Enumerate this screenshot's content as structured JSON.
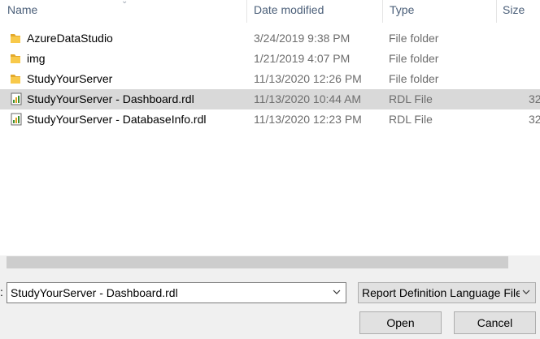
{
  "header": {
    "name": "Name",
    "date_modified": "Date modified",
    "type": "Type",
    "size": "Size"
  },
  "rows": [
    {
      "name": "AzureDataStudio",
      "date": "3/24/2019 9:38 PM",
      "type": "File folder",
      "size": "",
      "icon": "folder-icon",
      "selected": false
    },
    {
      "name": "img",
      "date": "1/21/2019 4:07 PM",
      "type": "File folder",
      "size": "",
      "icon": "folder-icon",
      "selected": false
    },
    {
      "name": "StudyYourServer",
      "date": "11/13/2020 12:26 PM",
      "type": "File folder",
      "size": "",
      "icon": "folder-icon",
      "selected": false
    },
    {
      "name": "StudyYourServer - Dashboard.rdl",
      "date": "11/13/2020 10:44 AM",
      "type": "RDL File",
      "size": "32",
      "icon": "rdl-file-icon",
      "selected": true
    },
    {
      "name": "StudyYourServer - DatabaseInfo.rdl",
      "date": "11/13/2020 12:23 PM",
      "type": "RDL File",
      "size": "32",
      "icon": "rdl-file-icon",
      "selected": false
    }
  ],
  "filename": {
    "label_fragment": ":",
    "value": "StudyYourServer - Dashboard.rdl"
  },
  "file_type": {
    "selected": "Report Definition Language File"
  },
  "buttons": {
    "open": "Open",
    "cancel": "Cancel"
  },
  "colors": {
    "folder": "#f8c94a",
    "selection": "#d9d9d9",
    "header_text": "#4c607a"
  }
}
